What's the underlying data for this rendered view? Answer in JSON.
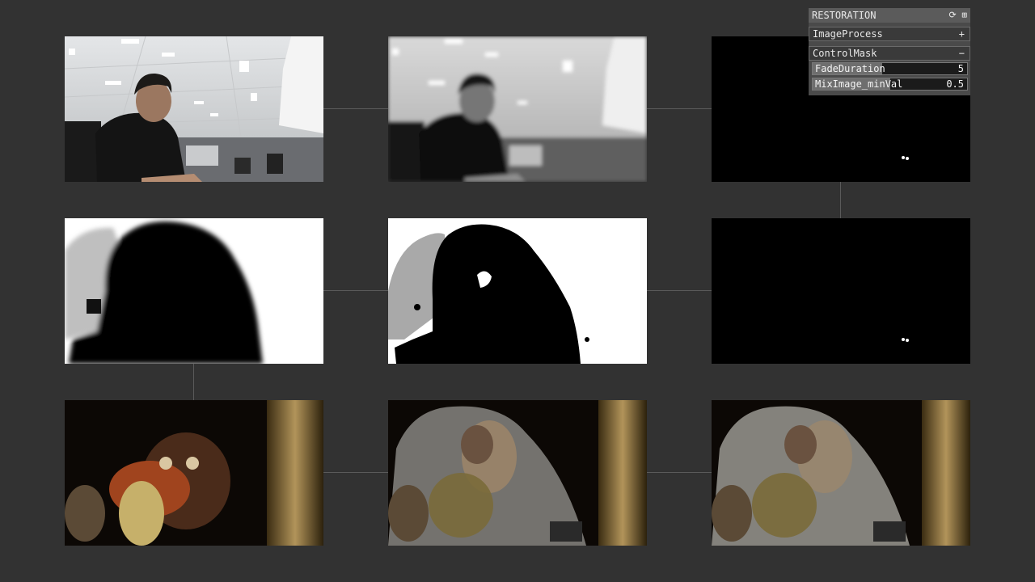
{
  "panel": {
    "title": "RESTORATION",
    "icon_reload": "reload-icon",
    "icon_save": "save-icon",
    "groups": [
      {
        "label": "ImageProcess",
        "toggle": "+"
      },
      {
        "label": "ControlMask",
        "toggle": "−"
      }
    ],
    "params": [
      {
        "label": "FadeDuration",
        "value": "5",
        "fill": 0.45
      },
      {
        "label": "MixImage_minVal",
        "value": "0.5",
        "fill": 0.5
      }
    ]
  }
}
